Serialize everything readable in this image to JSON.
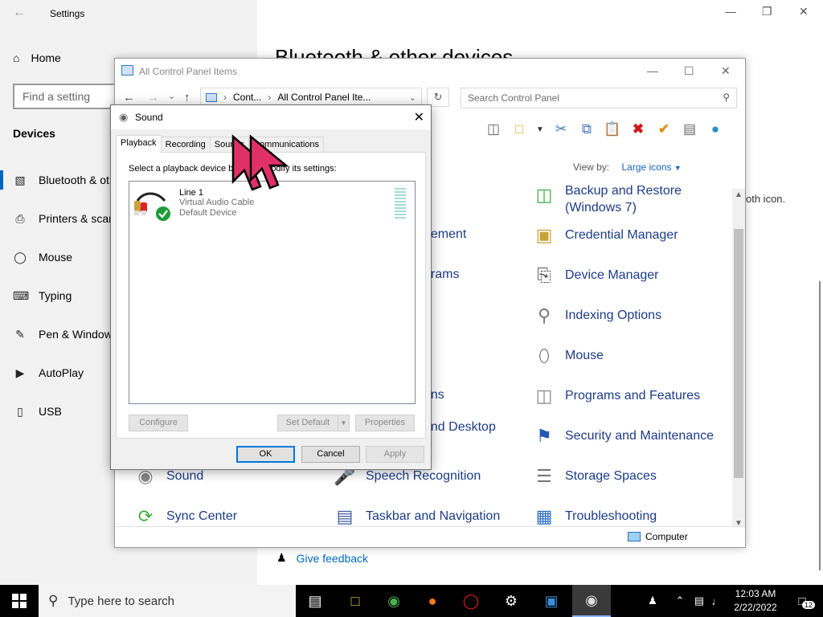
{
  "settings": {
    "title": "Settings",
    "home": "Home",
    "search_placeholder": "Find a setting",
    "section": "Devices",
    "nav": [
      {
        "label": "Bluetooth & other devices",
        "icon": "bluetooth-icon"
      },
      {
        "label": "Printers & scanners",
        "icon": "printer-icon"
      },
      {
        "label": "Mouse",
        "icon": "mouse-icon"
      },
      {
        "label": "Typing",
        "icon": "keyboard-icon"
      },
      {
        "label": "Pen & Windows Ink",
        "icon": "pen-icon"
      },
      {
        "label": "AutoPlay",
        "icon": "autoplay-icon"
      },
      {
        "label": "USB",
        "icon": "usb-icon"
      }
    ],
    "heading": "Bluetooth & other devices",
    "side_text": "oth icon.",
    "feedback": "Give feedback"
  },
  "control_panel": {
    "title": "All Control Panel Items",
    "breadcrumb": [
      "Cont...",
      "All Control Panel Ite..."
    ],
    "search_placeholder": "Search Control Panel",
    "view_by_label": "View by:",
    "view_by_value": "Large icons",
    "status_computer": "Computer",
    "items_col1": [
      {
        "label": "Sound",
        "icon": "speaker-icon"
      },
      {
        "label": "Sync Center",
        "icon": "sync-icon"
      }
    ],
    "items_col2": [
      {
        "label": "gement",
        "icon": "none"
      },
      {
        "label": "grams",
        "icon": "none"
      },
      {
        "label": "ons",
        "icon": "none"
      },
      {
        "label": "and Desktop",
        "icon": "none"
      },
      {
        "label": "s",
        "icon": "none"
      },
      {
        "label": "Speech Recognition",
        "icon": "microphone-icon"
      },
      {
        "label": "Taskbar and Navigation",
        "icon": "taskbar-icon"
      }
    ],
    "items_col3": [
      {
        "label": "Backup and Restore",
        "icon": "backup-icon"
      },
      {
        "label": "(Windows 7)",
        "icon": "none"
      },
      {
        "label": "Credential Manager",
        "icon": "vault-icon"
      },
      {
        "label": "Device Manager",
        "icon": "device-manager-icon"
      },
      {
        "label": "Indexing Options",
        "icon": "magnifier-icon"
      },
      {
        "label": "Mouse",
        "icon": "mouse-icon"
      },
      {
        "label": "Programs and Features",
        "icon": "programs-icon"
      },
      {
        "label": "Security and Maintenance",
        "icon": "flag-icon"
      },
      {
        "label": "Storage Spaces",
        "icon": "storage-icon"
      },
      {
        "label": "Troubleshooting",
        "icon": "troubleshoot-icon"
      }
    ]
  },
  "sound_dialog": {
    "title": "Sound",
    "tabs": [
      "Playback",
      "Recording",
      "Sounds",
      "Communications"
    ],
    "selected_tab": "Playback",
    "instruction": "Select a playback device below to modify its settings:",
    "device": {
      "name": "Line 1",
      "subtitle": "Virtual Audio Cable",
      "status": "Default Device"
    },
    "buttons": {
      "configure": "Configure",
      "set_default": "Set Default",
      "properties": "Properties",
      "ok": "OK",
      "cancel": "Cancel",
      "apply": "Apply"
    }
  },
  "taskbar": {
    "search_placeholder": "Type here to search",
    "time": "12:03 AM",
    "date": "2/22/2022",
    "notification_count": "12"
  },
  "colors": {
    "accent": "#0067c0",
    "link": "#1c3c87",
    "cursor": "#e0306a",
    "ok_border": "#0078d7"
  }
}
